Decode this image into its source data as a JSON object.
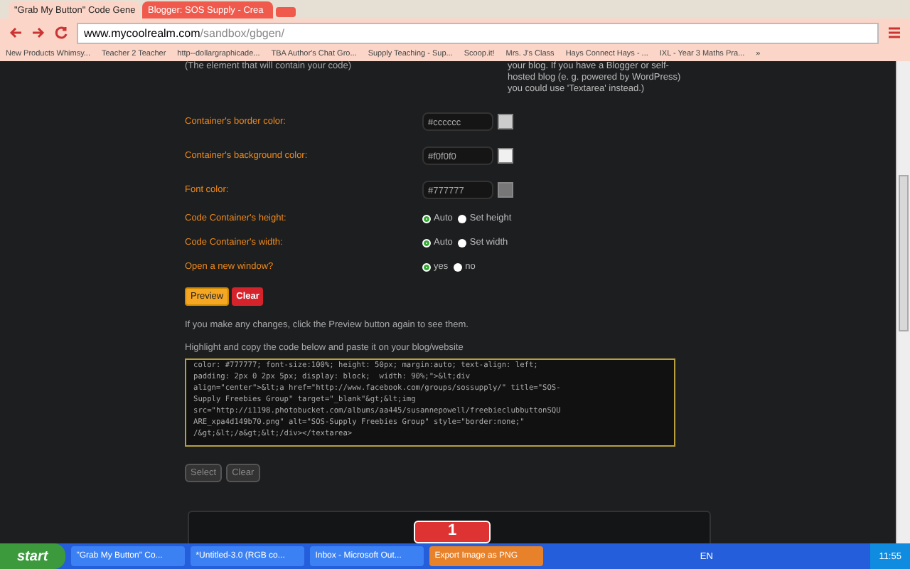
{
  "browser": {
    "tabs": [
      {
        "title": "\"Grab My Button\" Code Gene",
        "selected": true
      },
      {
        "title": "Blogger: SOS Supply - Crea",
        "selected": false
      }
    ],
    "url_host": "www.mycoolrealm.com",
    "url_path": "/sandbox/gbgen/",
    "bookmarks": [
      "New Products Whimsy...",
      "Teacher 2 Teacher",
      "http--dollargraphicade...",
      "TBA Author's Chat Gro...",
      "Supply Teaching - Sup...",
      "Scoop.it!",
      "Mrs. J's Class",
      "Hays Connect Hays - ...",
      "IXL - Year 3 Maths Pra..."
    ],
    "bookmarks_more": "»"
  },
  "page": {
    "left_note": "(The element that will contain your code)",
    "right_note": "your blog. If you have a Blogger or self-\nhosted blog (e. g. powered by WordPress)\nyou could use 'Textarea' instead.)",
    "color_fields": [
      {
        "label": "Container's border color:",
        "value": "#cccccc",
        "color": "#cccccc"
      },
      {
        "label": "Container's background color:",
        "value": "#f0f0f0",
        "color": "#f0f0f0"
      },
      {
        "label": "Font color:",
        "value": "#777777",
        "color": "#777777"
      }
    ],
    "radio_groups": [
      {
        "label": "Code Container's height:",
        "options": [
          {
            "label": "Auto",
            "selected": true
          },
          {
            "label": "Set height",
            "selected": false
          }
        ]
      },
      {
        "label": "Code Container's width:",
        "options": [
          {
            "label": "Auto",
            "selected": true
          },
          {
            "label": "Set width",
            "selected": false
          }
        ]
      },
      {
        "label": "Open a new window?",
        "options": [
          {
            "label": "yes",
            "selected": true
          },
          {
            "label": "no",
            "selected": false
          }
        ]
      }
    ],
    "preview_button": "Preview",
    "clear_button": "Clear",
    "hint": "If you make any changes, click the Preview button again to see them.",
    "copy_label": "Highlight and copy the code below and paste it on your blog/website",
    "code": "color: #777777; font-size:100%; height: 50px; margin:auto; text-align: left;\npadding: 2px 0 2px 5px; display: block;  width: 90%;\">&lt;div\nalign=\"center\">&lt;a href=\"http://www.facebook.com/groups/sossupply/\" title=\"SOS-\nSupply Freebies Group\" target=\"_blank\"&gt;&lt;img\nsrc=\"http://i1198.photobucket.com/albums/aa445/susannepowell/freebieclubbuttonSQU\nARE_xpa4d149b70.png\" alt=\"SOS-Supply Freebies Group\" style=\"border:none;\"\n/&gt;&lt;/a&gt;&lt;/div></textarea>",
    "select_button": "Select",
    "clear_code_button": "Clear",
    "badge": "1"
  },
  "taskbar": {
    "start": "start",
    "items": [
      {
        "label": "\"Grab My Button\" Co...",
        "selected": false
      },
      {
        "label": "*Untitled-3.0 (RGB co...",
        "selected": false
      },
      {
        "label": "Inbox - Microsoft Out...",
        "selected": false
      },
      {
        "label": "Export Image as PNG",
        "selected": true
      }
    ],
    "language": "EN",
    "clock": "11:55"
  }
}
